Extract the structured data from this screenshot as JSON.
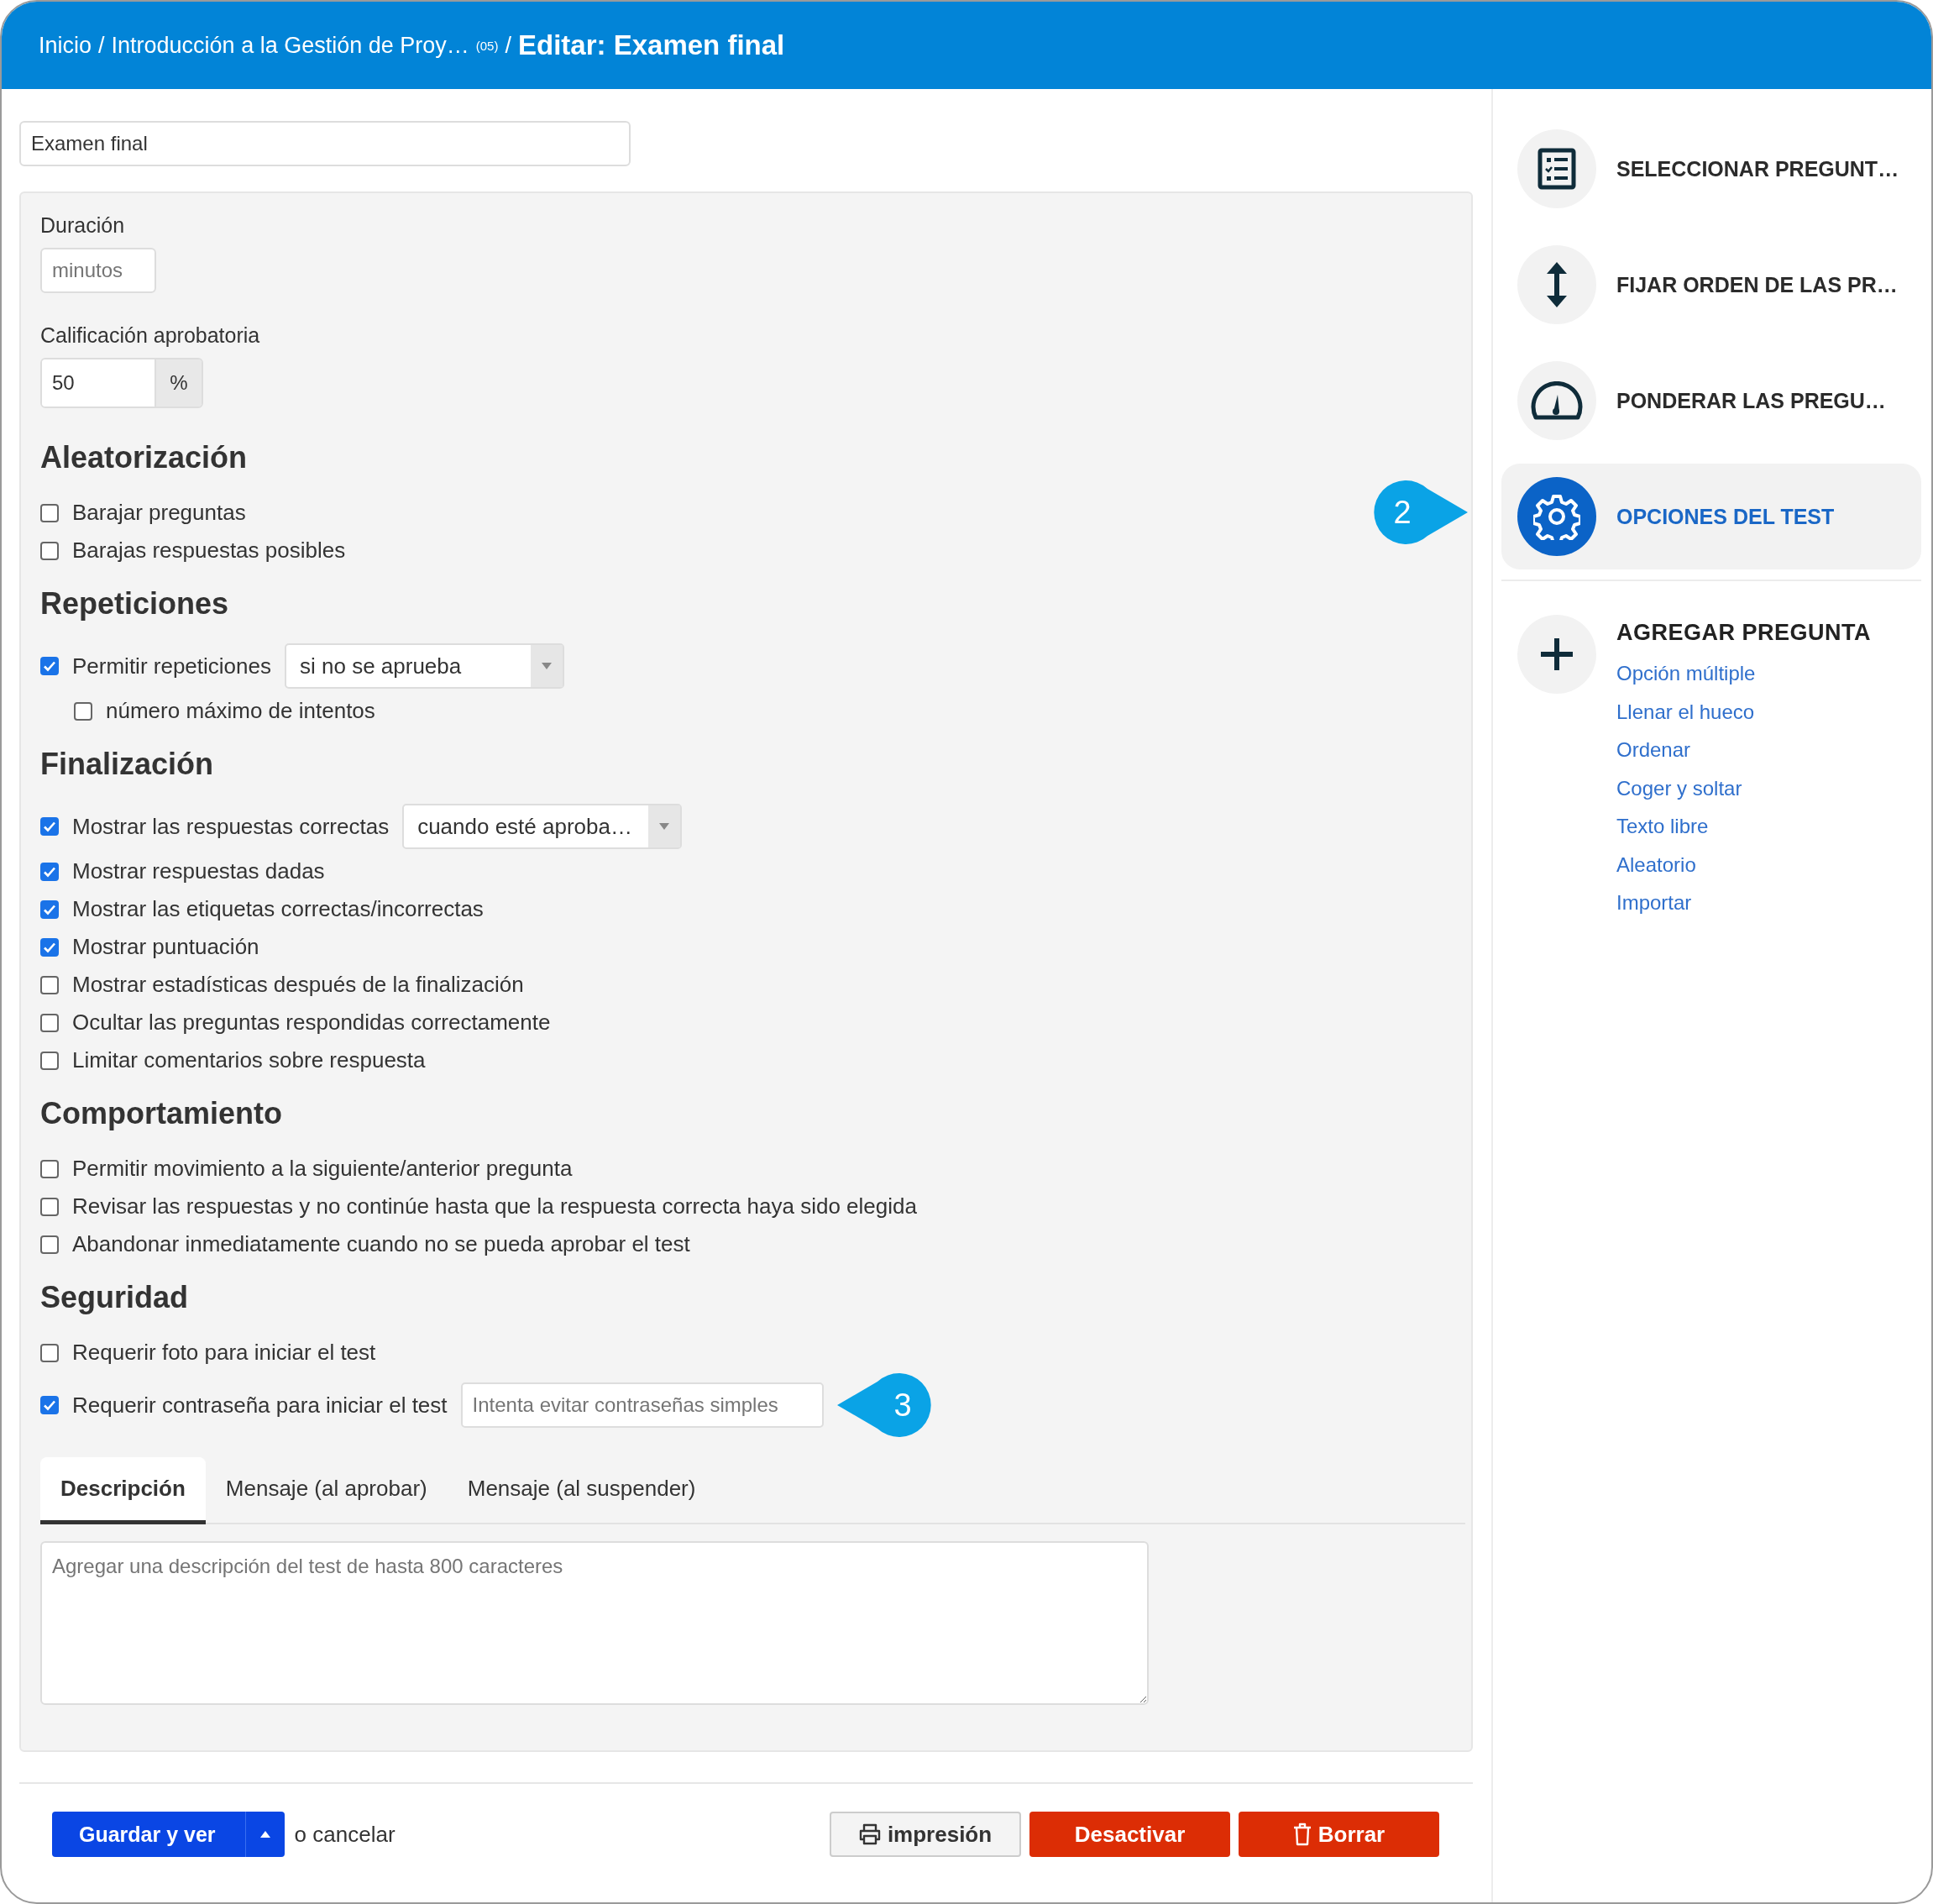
{
  "header": {
    "breadcrumbs": [
      "Inicio",
      "Introducción a la Gestión de Proy…"
    ],
    "count": "(05)",
    "separator": "/",
    "title": "Editar: Examen final"
  },
  "title_field": {
    "value": "Examen final"
  },
  "duration": {
    "label": "Duración",
    "placeholder": "minutos"
  },
  "passing_grade": {
    "label": "Calificación aprobatoria",
    "value": "50",
    "unit": "%"
  },
  "sections": [
    {
      "title": "Aleatorización",
      "options": [
        {
          "label": "Barajar preguntas",
          "checked": false
        },
        {
          "label": "Barajas respuestas posibles",
          "checked": false
        }
      ]
    },
    {
      "title": "Repeticiones",
      "options": [
        {
          "label": "Permitir repeticiones",
          "checked": true,
          "select": {
            "value": "si no se aprueba"
          },
          "children": [
            {
              "label": "número máximo de intentos",
              "checked": false
            }
          ]
        }
      ]
    },
    {
      "title": "Finalización",
      "options": [
        {
          "label": "Mostrar las respuestas correctas",
          "checked": true,
          "select": {
            "value": "cuando esté aproba…"
          }
        },
        {
          "label": "Mostrar respuestas dadas",
          "checked": true
        },
        {
          "label": "Mostrar las etiquetas correctas/incorrectas",
          "checked": true
        },
        {
          "label": "Mostrar puntuación",
          "checked": true
        },
        {
          "label": "Mostrar estadísticas después de la finalización",
          "checked": false
        },
        {
          "label": "Ocultar las preguntas respondidas correctamente",
          "checked": false
        },
        {
          "label": "Limitar comentarios sobre respuesta",
          "checked": false
        }
      ]
    },
    {
      "title": "Comportamiento",
      "options": [
        {
          "label": "Permitir movimiento a la siguiente/anterior pregunta",
          "checked": false
        },
        {
          "label": "Revisar las respuestas y no continúe hasta que la respuesta correcta haya sido elegida",
          "checked": false
        },
        {
          "label": "Abandonar inmediatamente cuando no se pueda aprobar el test",
          "checked": false
        }
      ]
    },
    {
      "title": "Seguridad",
      "options": [
        {
          "label": "Requerir foto para iniciar el test",
          "checked": false
        },
        {
          "label": "Requerir contraseña para iniciar el test",
          "checked": true,
          "field": {
            "placeholder": "Intenta evitar contraseñas simples"
          },
          "callout": "3"
        }
      ]
    }
  ],
  "tabs": [
    {
      "label": "Descripción",
      "selected": true
    },
    {
      "label": "Mensaje (al aprobar)",
      "selected": false
    },
    {
      "label": "Mensaje (al suspender)",
      "selected": false
    }
  ],
  "description": {
    "placeholder": "Agregar una descripción del test de hasta 800 caracteres"
  },
  "footer": {
    "save": "Guardar y ver",
    "cancel": "o cancelar",
    "buttons": [
      {
        "kind": "print",
        "label": "impresión"
      },
      {
        "kind": "deactivate",
        "label": "Desactivar"
      },
      {
        "kind": "delete",
        "label": "Borrar"
      }
    ]
  },
  "sidebar": {
    "actions": [
      {
        "kind": "select",
        "label": "SELECCIONAR PREGUNT…",
        "selected": false
      },
      {
        "kind": "order",
        "label": "FIJAR ORDEN DE LAS PR…",
        "selected": false
      },
      {
        "kind": "weight",
        "label": "PONDERAR LAS PREGU…",
        "selected": false
      },
      {
        "kind": "options",
        "label": "OPCIONES DEL TEST",
        "selected": true,
        "callout": "2"
      }
    ],
    "add": {
      "title": "AGREGAR PREGUNTA",
      "links": [
        "Opción múltiple",
        "Llenar el hueco",
        "Ordenar",
        "Coger y soltar",
        "Texto libre",
        "Aleatorio",
        "Importar"
      ]
    }
  }
}
